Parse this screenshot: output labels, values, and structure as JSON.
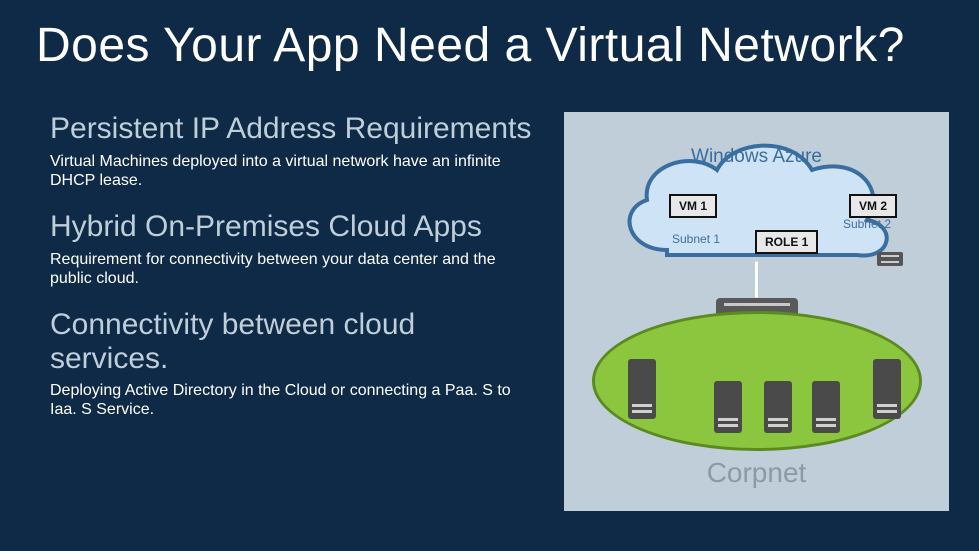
{
  "title": "Does Your App Need a Virtual Network?",
  "sections": [
    {
      "heading": "Persistent IP Address Requirements",
      "body": "Virtual Machines deployed into a virtual network have an infinite DHCP lease."
    },
    {
      "heading": "Hybrid On-Premises Cloud Apps",
      "body": "Requirement for connectivity between your data center and the public cloud."
    },
    {
      "heading": "Connectivity between cloud services.",
      "body": "Deploying Active Directory in the Cloud or connecting a Paa. S to Iaa. S Service."
    }
  ],
  "diagram": {
    "cloud_label": "Windows Azure",
    "vm1": "VM 1",
    "vm2": "VM 2",
    "role1": "ROLE 1",
    "subnet1": "Subnet 1",
    "subnet2": "Subnet 2",
    "corpnet": "Corpnet"
  }
}
